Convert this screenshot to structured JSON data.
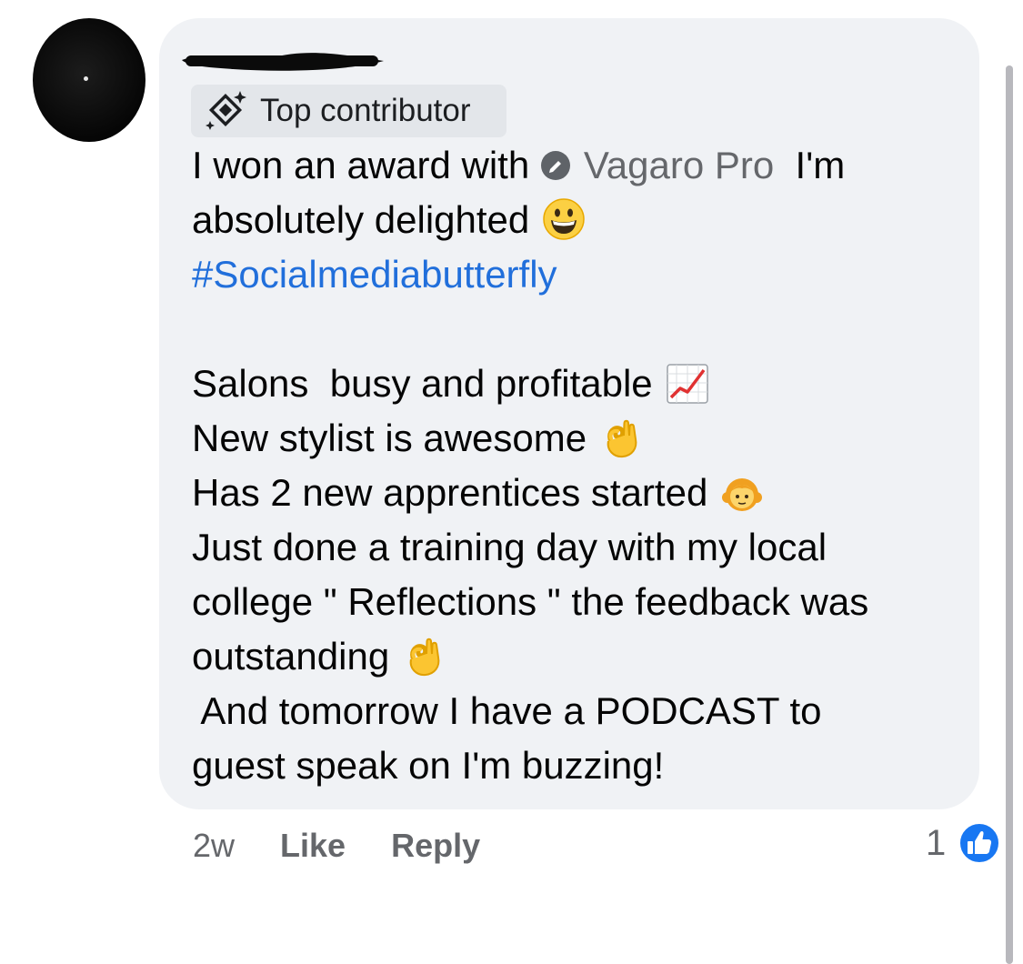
{
  "comment": {
    "badge_label": "Top contributor",
    "lines": [
      {
        "before": "I won an award with ",
        "mention": "Vagaro Pro",
        "after": "  I'm"
      },
      {
        "text": "absolutely delighted",
        "emoji": "grinning-face"
      },
      {
        "hashtag": "#Socialmediabutterfly"
      },
      {
        "text": "Salons  busy and profitable",
        "emoji": "chart-increasing"
      },
      {
        "text": "New stylist is awesome",
        "emoji": "ok-hand"
      },
      {
        "text": "Has 2 new apprentices started",
        "emoji": "girl"
      },
      {
        "text": "Just done a training day with my local"
      },
      {
        "text": "college \" Reflections \" the feedback was"
      },
      {
        "text": "outstanding",
        "emoji": "ok-hand"
      },
      {
        "text": " And tomorrow I have a PODCAST to"
      },
      {
        "text": "guest speak on I'm buzzing!"
      }
    ]
  },
  "actions": {
    "timestamp": "2w",
    "like_label": "Like",
    "reply_label": "Reply",
    "reaction_count": "1"
  },
  "colors": {
    "bubble_bg": "#f0f2f5",
    "hashtag": "#216fdb",
    "mention": "#65676b",
    "meta_text": "#65676b",
    "like_blue": "#1877f2"
  },
  "icons": {
    "badge": "top-contributor-icon",
    "verified": "verified-badge-icon",
    "reaction": "like-reaction-icon"
  }
}
